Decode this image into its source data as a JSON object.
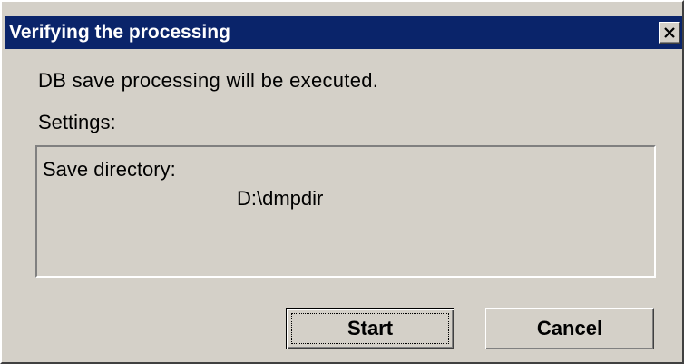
{
  "dialog": {
    "title": "Verifying the processing",
    "message": "DB save processing will be executed.",
    "settings_label": "Settings:",
    "settings": {
      "save_directory_label": "Save directory:",
      "save_directory_value": "D:\\dmpdir"
    },
    "buttons": {
      "start_label": "Start",
      "cancel_label": "Cancel"
    }
  },
  "icons": {
    "close": "close-icon"
  },
  "colors": {
    "titlebar": "#0a246a",
    "face": "#d4d0c8"
  }
}
